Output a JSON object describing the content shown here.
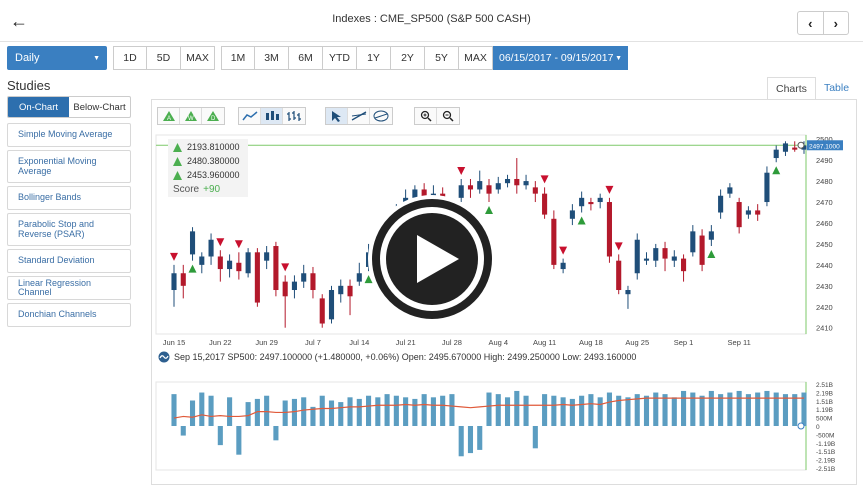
{
  "header": {
    "back_icon": "arrow-left-icon",
    "title": "Indexes : CME_SP500 (S&P 500 CASH)",
    "prev_icon": "chevron-left-icon",
    "next_icon": "chevron-right-icon"
  },
  "period": {
    "interval": "Daily",
    "group1": [
      "1D",
      "5D",
      "MAX"
    ],
    "group2": [
      "1M",
      "3M",
      "6M",
      "YTD",
      "1Y",
      "2Y",
      "5Y",
      "MAX"
    ],
    "date_range": "06/15/2017 - 09/15/2017"
  },
  "sidebar": {
    "heading": "Studies",
    "toggle": [
      "On-Chart",
      "Below-Chart"
    ],
    "studies": [
      "Simple Moving Average",
      "Exponential Moving Average",
      "Bollinger Bands",
      "Parabolic Stop and Reverse (PSAR)",
      "Standard Deviation",
      "Linear Regression Channel",
      "Donchian Channels"
    ]
  },
  "tabs": [
    "Charts",
    "Table"
  ],
  "legend": {
    "values": [
      "2193.810000",
      "2480.380000",
      "2453.960000"
    ],
    "score_label": "Score",
    "score_value": "+90"
  },
  "info_line": "Sep 15,2017 SP500: 2497.100000 (+1.480000, +0.06%) Open: 2495.670000 High: 2499.250000 Low: 2493.160000",
  "price_label": "2497.1000",
  "colors": {
    "up": "#1f4e79",
    "down": "#b3192b",
    "accent": "#3a7fc1",
    "line": "#7ec96a",
    "volume": "#5b9dc1",
    "volume_line": "#e05a3a"
  },
  "chart_data": {
    "type": "candlestick",
    "x_ticks": [
      "Jun 15",
      "Jun 22",
      "Jun 29",
      "Jul 7",
      "Jul 14",
      "Jul 21",
      "Jul 28",
      "Aug 4",
      "Aug 11",
      "Aug 18",
      "Aug 25",
      "Sep 1",
      "Sep 11"
    ],
    "y_ticks": [
      "2500",
      "2490",
      "2480",
      "2470",
      "2460",
      "2450",
      "2440",
      "2430",
      "2420",
      "2410"
    ],
    "ylim": [
      2407,
      2502
    ],
    "reference_line": 2497.1,
    "volume_y_ticks": [
      "2.51B",
      "2.19B",
      "1.51B",
      "1.19B",
      "500M",
      "0",
      "-500M",
      "-1.19B",
      "-1.51B",
      "-2.19B",
      "-2.51B"
    ],
    "candles": [
      {
        "o": 2428,
        "c": 2436,
        "h": 2440,
        "l": 2420
      },
      {
        "o": 2436,
        "c": 2430,
        "h": 2440,
        "l": 2424
      },
      {
        "o": 2445,
        "c": 2456,
        "h": 2458,
        "l": 2442
      },
      {
        "o": 2440,
        "c": 2444,
        "h": 2446,
        "l": 2436
      },
      {
        "o": 2444,
        "c": 2452,
        "h": 2455,
        "l": 2440
      },
      {
        "o": 2444,
        "c": 2438,
        "h": 2447,
        "l": 2432
      },
      {
        "o": 2438,
        "c": 2442,
        "h": 2445,
        "l": 2434
      },
      {
        "o": 2441,
        "c": 2437,
        "h": 2446,
        "l": 2433
      },
      {
        "o": 2436,
        "c": 2446,
        "h": 2448,
        "l": 2434
      },
      {
        "o": 2446,
        "c": 2422,
        "h": 2448,
        "l": 2420
      },
      {
        "o": 2442,
        "c": 2446,
        "h": 2449,
        "l": 2438
      },
      {
        "o": 2449,
        "c": 2428,
        "h": 2451,
        "l": 2425
      },
      {
        "o": 2432,
        "c": 2425,
        "h": 2435,
        "l": 2410
      },
      {
        "o": 2428,
        "c": 2432,
        "h": 2435,
        "l": 2424
      },
      {
        "o": 2432,
        "c": 2436,
        "h": 2440,
        "l": 2429
      },
      {
        "o": 2436,
        "c": 2428,
        "h": 2439,
        "l": 2424
      },
      {
        "o": 2424,
        "c": 2412,
        "h": 2426,
        "l": 2410
      },
      {
        "o": 2414,
        "c": 2428,
        "h": 2430,
        "l": 2412
      },
      {
        "o": 2426,
        "c": 2430,
        "h": 2433,
        "l": 2422
      },
      {
        "o": 2430,
        "c": 2425,
        "h": 2433,
        "l": 2416
      },
      {
        "o": 2432,
        "c": 2436,
        "h": 2441,
        "l": 2430
      },
      {
        "o": 2439,
        "c": 2446,
        "h": 2450,
        "l": 2437
      },
      {
        "o": 2445,
        "c": 2449,
        "h": 2452,
        "l": 2442
      },
      {
        "o": 2449,
        "c": 2460,
        "h": 2463,
        "l": 2447
      },
      {
        "o": 2461,
        "c": 2466,
        "h": 2469,
        "l": 2459
      },
      {
        "o": 2468,
        "c": 2472,
        "h": 2476,
        "l": 2466
      },
      {
        "o": 2472,
        "c": 2476,
        "h": 2478,
        "l": 2469
      },
      {
        "o": 2476,
        "c": 2470,
        "h": 2479,
        "l": 2466
      },
      {
        "o": 2468,
        "c": 2474,
        "h": 2478,
        "l": 2465
      },
      {
        "o": 2474,
        "c": 2466,
        "h": 2477,
        "l": 2455
      },
      {
        "o": 2456,
        "c": 2448,
        "h": 2460,
        "l": 2446
      },
      {
        "o": 2472,
        "c": 2478,
        "h": 2481,
        "l": 2470
      },
      {
        "o": 2478,
        "c": 2476,
        "h": 2481,
        "l": 2472
      },
      {
        "o": 2476,
        "c": 2480,
        "h": 2485,
        "l": 2474
      },
      {
        "o": 2478,
        "c": 2474,
        "h": 2481,
        "l": 2470
      },
      {
        "o": 2476,
        "c": 2479,
        "h": 2482,
        "l": 2474
      },
      {
        "o": 2479,
        "c": 2481,
        "h": 2483,
        "l": 2477
      },
      {
        "o": 2481,
        "c": 2478,
        "h": 2491,
        "l": 2474
      },
      {
        "o": 2478,
        "c": 2480,
        "h": 2483,
        "l": 2476
      },
      {
        "o": 2477,
        "c": 2474,
        "h": 2480,
        "l": 2470
      },
      {
        "o": 2474,
        "c": 2464,
        "h": 2477,
        "l": 2462
      },
      {
        "o": 2462,
        "c": 2440,
        "h": 2466,
        "l": 2438
      },
      {
        "o": 2438,
        "c": 2441,
        "h": 2443,
        "l": 2436
      },
      {
        "o": 2462,
        "c": 2466,
        "h": 2469,
        "l": 2459
      },
      {
        "o": 2468,
        "c": 2472,
        "h": 2475,
        "l": 2465
      },
      {
        "o": 2470,
        "c": 2469,
        "h": 2472,
        "l": 2466
      },
      {
        "o": 2470,
        "c": 2472,
        "h": 2474,
        "l": 2467
      },
      {
        "o": 2470,
        "c": 2444,
        "h": 2472,
        "l": 2441
      },
      {
        "o": 2442,
        "c": 2428,
        "h": 2445,
        "l": 2426
      },
      {
        "o": 2426,
        "c": 2428,
        "h": 2430,
        "l": 2419
      },
      {
        "o": 2436,
        "c": 2452,
        "h": 2455,
        "l": 2433
      },
      {
        "o": 2442,
        "c": 2443,
        "h": 2446,
        "l": 2440
      },
      {
        "o": 2442,
        "c": 2448,
        "h": 2450,
        "l": 2439
      },
      {
        "o": 2448,
        "c": 2443,
        "h": 2451,
        "l": 2437
      },
      {
        "o": 2442,
        "c": 2444,
        "h": 2447,
        "l": 2439
      },
      {
        "o": 2443,
        "c": 2437,
        "h": 2445,
        "l": 2432
      },
      {
        "o": 2446,
        "c": 2456,
        "h": 2459,
        "l": 2444
      },
      {
        "o": 2454,
        "c": 2440,
        "h": 2457,
        "l": 2437
      },
      {
        "o": 2452,
        "c": 2456,
        "h": 2459,
        "l": 2449
      },
      {
        "o": 2465,
        "c": 2473,
        "h": 2476,
        "l": 2462
      },
      {
        "o": 2474,
        "c": 2477,
        "h": 2479,
        "l": 2472
      },
      {
        "o": 2470,
        "c": 2458,
        "h": 2472,
        "l": 2455
      },
      {
        "o": 2464,
        "c": 2466,
        "h": 2468,
        "l": 2462
      },
      {
        "o": 2466,
        "c": 2464,
        "h": 2469,
        "l": 2461
      },
      {
        "o": 2470,
        "c": 2484,
        "h": 2487,
        "l": 2468
      },
      {
        "o": 2491,
        "c": 2495,
        "h": 2497,
        "l": 2489
      },
      {
        "o": 2494,
        "c": 2498,
        "h": 2499,
        "l": 2492
      },
      {
        "o": 2496,
        "c": 2495,
        "h": 2499,
        "l": 2494
      },
      {
        "o": 2495,
        "c": 2497,
        "h": 2499,
        "l": 2493
      }
    ],
    "volume": [
      2.0,
      -0.6,
      1.6,
      2.1,
      1.9,
      -1.2,
      1.8,
      -1.8,
      1.5,
      1.7,
      1.9,
      -0.9,
      1.6,
      1.7,
      1.8,
      1.2,
      1.9,
      1.6,
      1.5,
      1.8,
      1.7,
      1.9,
      1.8,
      2.0,
      1.9,
      1.8,
      1.7,
      2.0,
      1.8,
      1.9,
      2.0,
      -1.9,
      -1.7,
      -1.5,
      2.1,
      2.0,
      1.8,
      2.2,
      1.9,
      -1.4,
      2.0,
      1.9,
      1.8,
      1.7,
      1.9,
      2.0,
      1.8,
      2.1,
      1.9,
      1.8,
      2.0,
      1.9,
      2.1,
      2.0,
      1.8,
      2.2,
      2.1,
      1.9,
      2.2,
      2.0,
      2.1,
      2.2,
      2.0,
      2.1,
      2.2,
      2.1,
      2.0,
      2.0,
      2.1
    ],
    "volume_avg": [
      0.5,
      0.6,
      0.55,
      0.7,
      0.6,
      0.65,
      0.6,
      0.6,
      0.65,
      0.9,
      0.9,
      0.85,
      0.85,
      0.9,
      1.0,
      1.05,
      1.1,
      1.1,
      1.15,
      1.2,
      1.2,
      1.25,
      1.3,
      1.3,
      1.3,
      1.35,
      1.3,
      1.35,
      1.3,
      1.3,
      1.25,
      1.2,
      1.15,
      1.2,
      1.25,
      1.3,
      1.3,
      1.3,
      1.3,
      1.3,
      1.3,
      1.3,
      1.35,
      1.3,
      1.35,
      1.4,
      1.35,
      1.5,
      1.6,
      1.65,
      1.7,
      1.75,
      1.75,
      1.75,
      1.75,
      1.75,
      1.75,
      1.75,
      1.75,
      1.75,
      1.75,
      1.75,
      1.75,
      1.75,
      1.75,
      1.75,
      1.75,
      1.75,
      1.75
    ],
    "signals": [
      {
        "i": 0,
        "type": "down"
      },
      {
        "i": 2,
        "type": "up"
      },
      {
        "i": 5,
        "type": "down"
      },
      {
        "i": 7,
        "type": "down"
      },
      {
        "i": 12,
        "type": "down"
      },
      {
        "i": 21,
        "type": "up"
      },
      {
        "i": 31,
        "type": "down"
      },
      {
        "i": 34,
        "type": "up"
      },
      {
        "i": 40,
        "type": "down"
      },
      {
        "i": 42,
        "type": "down"
      },
      {
        "i": 44,
        "type": "up"
      },
      {
        "i": 47,
        "type": "down"
      },
      {
        "i": 48,
        "type": "down"
      },
      {
        "i": 58,
        "type": "up"
      },
      {
        "i": 65,
        "type": "up"
      }
    ]
  }
}
